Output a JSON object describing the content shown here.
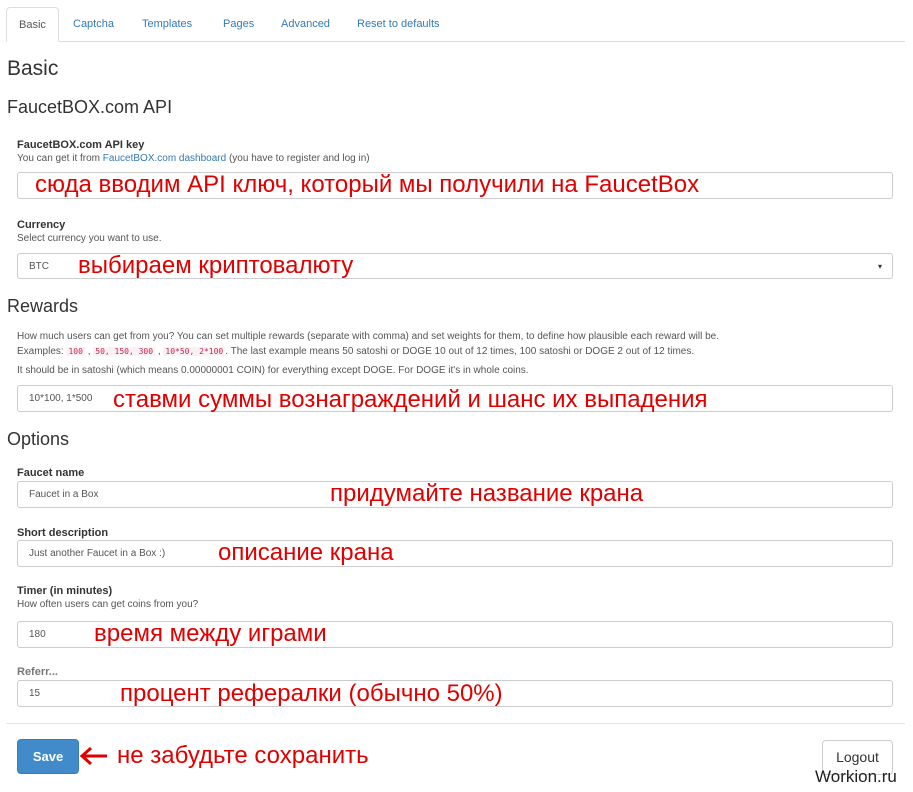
{
  "tabs": [
    "Basic",
    "Captcha",
    "Templates",
    "Pages",
    "Advanced",
    "Reset to defaults"
  ],
  "page_title": "Basic",
  "sections": {
    "api": "FaucetBOX.com API",
    "rewards": "Rewards",
    "options": "Options"
  },
  "api_key": {
    "label": "FaucetBOX.com API key",
    "help_prefix": "You can get it from ",
    "help_link": "FaucetBOX.com dashboard",
    "help_suffix": " (you have to register and log in)",
    "value": ""
  },
  "currency": {
    "label": "Currency",
    "help": "Select currency you want to use.",
    "value": "BTC"
  },
  "rewards": {
    "help1": "How much users can get from you? You can set multiple rewards (separate with comma) and set weights for them, to define how plausible each reward will be.",
    "examples_label": "Examples: ",
    "examples": [
      "100",
      "50, 150, 300",
      "10*50, 2*100"
    ],
    "examples_suffix": ". The last example means 50 satoshi or DOGE 10 out of 12 times, 100 satoshi or DOGE 2 out of 12 times.",
    "help2": "It should be in satoshi (which means 0.00000001 COIN) for everything except DOGE. For DOGE it's in whole coins.",
    "value": "10*100, 1*500"
  },
  "faucet_name": {
    "label": "Faucet name",
    "value": "Faucet in a Box"
  },
  "short_description": {
    "label": "Short description",
    "value": "Just another Faucet in a Box :)"
  },
  "timer": {
    "label": "Timer (in minutes)",
    "help": "How often users can get coins from you?",
    "value": "180"
  },
  "referral": {
    "label": "Referr...",
    "value": "15"
  },
  "buttons": {
    "save": "Save",
    "logout": "Logout"
  },
  "annotations": {
    "api_key": "сюда вводим API ключ, который мы получили на FaucetBox",
    "currency": "выбираем криптовалюту",
    "rewards": "ставми суммы вознаграждений и шанс их выпадения",
    "faucet_name": "придумайте название крана",
    "description": "описание крана",
    "timer": "время между играми",
    "referral": "процент рефералки (обычно 50%)",
    "save": "не забудьте сохранить"
  },
  "watermark": "Workion.ru",
  "colors": {
    "annotation": "#e00000",
    "primary": "#428bca",
    "link": "#337ab7"
  }
}
